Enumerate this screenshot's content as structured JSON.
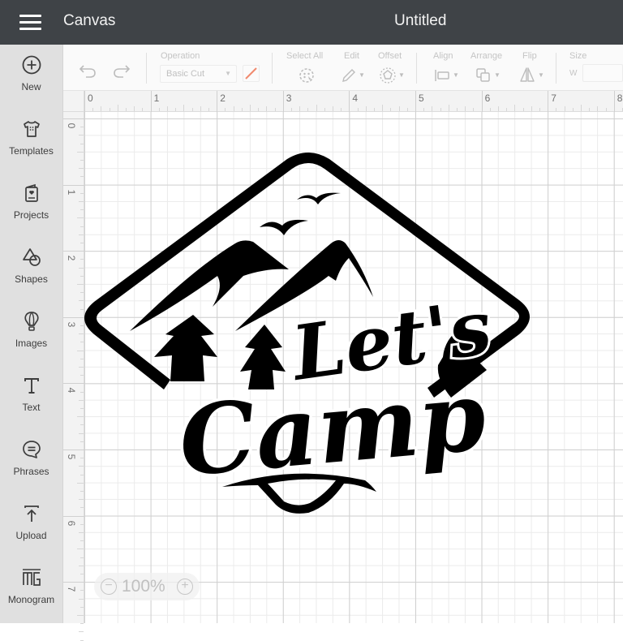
{
  "header": {
    "app_title": "Canvas",
    "document_title": "Untitled"
  },
  "sidebar": {
    "items": [
      {
        "label": "New",
        "icon": "plus-circle-icon"
      },
      {
        "label": "Templates",
        "icon": "shirt-icon"
      },
      {
        "label": "Projects",
        "icon": "project-card-icon"
      },
      {
        "label": "Shapes",
        "icon": "shapes-icon"
      },
      {
        "label": "Images",
        "icon": "balloon-icon"
      },
      {
        "label": "Text",
        "icon": "text-icon"
      },
      {
        "label": "Phrases",
        "icon": "speech-bubble-icon"
      },
      {
        "label": "Upload",
        "icon": "upload-icon"
      },
      {
        "label": "Monogram",
        "icon": "monogram-icon"
      }
    ]
  },
  "toolbar": {
    "operation_label": "Operation",
    "operation_value": "Basic Cut",
    "select_all_label": "Select All",
    "edit_label": "Edit",
    "offset_label": "Offset",
    "align_label": "Align",
    "arrange_label": "Arrange",
    "flip_label": "Flip",
    "size_label": "Size",
    "width_prefix": "W",
    "width_value": "",
    "swatch_color": "#f08a6e"
  },
  "rulers": {
    "horizontal": [
      "0",
      "1",
      "2",
      "3",
      "4",
      "5",
      "6",
      "7",
      "8"
    ],
    "vertical": [
      "0",
      "1",
      "2",
      "3",
      "4",
      "5",
      "6",
      "7"
    ]
  },
  "design": {
    "headline_top": "Let's",
    "headline_bottom": "Camp",
    "fill_color": "#000000"
  },
  "zoom": {
    "value": "100%",
    "minus": "−",
    "plus": "+"
  }
}
